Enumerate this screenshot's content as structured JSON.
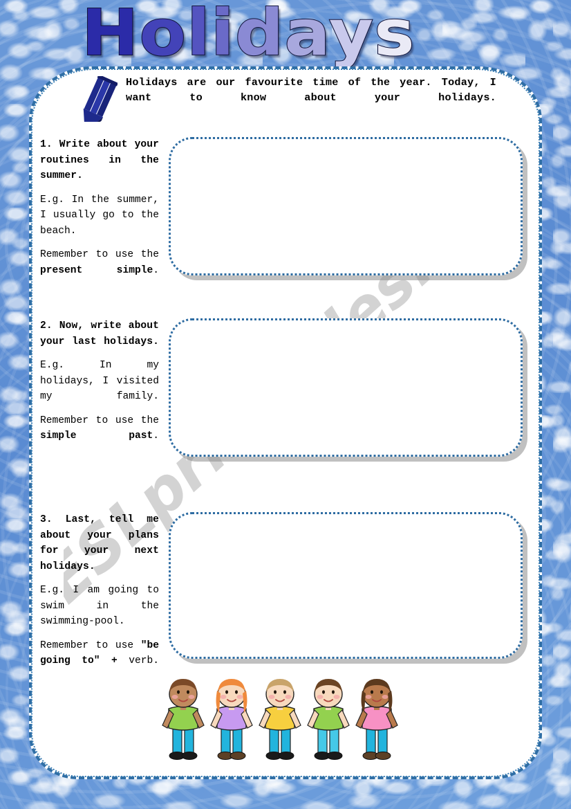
{
  "worksheet": {
    "title": "Holidays",
    "title_letters": [
      "H",
      "o",
      "l",
      "i",
      "d",
      "a",
      "y",
      "s"
    ],
    "title_letter_colors": [
      "#2b2ba8",
      "#4343b8",
      "#5454c0",
      "#6a6ac8",
      "#8a8ad4",
      "#a8a8de",
      "#c9c9ec",
      "#eaeaf6"
    ],
    "watermark": "ESLprintables.com",
    "background_color": "#5d8ed5",
    "card_color": "#ffffff",
    "border_color": "#2e6ca2",
    "pencil_color": "#1e2a8c"
  },
  "header": {
    "icon": "pencil-icon",
    "intro": "Holidays are our favourite time of the year. Today, I want to know about your holidays."
  },
  "tasks": [
    {
      "number": "1.",
      "heading": "1. Write about your routines in the summer.",
      "example": "E.g. In the summer, I usually go to the beach.",
      "reminder_prefix": "Remember to use the ",
      "reminder_bold": "present simple",
      "reminder_suffix": ".",
      "answer_placeholder": ""
    },
    {
      "number": "2.",
      "heading": "2. Now, write about your last holidays.",
      "example": "E.g. In my holidays, I visited my family.",
      "reminder_prefix": "Remember to use the ",
      "reminder_bold": "simple past",
      "reminder_suffix": ".",
      "answer_placeholder": ""
    },
    {
      "number": "3.",
      "heading": "3. Last, tell me about your plans for your next holidays.",
      "example": "E.g. I am going to swim in the swimming-pool.",
      "reminder_prefix": "Remember to use ",
      "reminder_bold": "\"be going to\" +",
      "reminder_suffix": " verb.",
      "answer_placeholder": ""
    }
  ],
  "illustration": {
    "name": "five-children-holding-hands",
    "children": [
      {
        "hair": "#7b4a28",
        "skin": "#c08a5e",
        "shirt": "#93d14f",
        "pants": "#22b4dd",
        "shoes": "#1a1a1a"
      },
      {
        "hair": "#ef8a3c",
        "skin": "#f7d9bd",
        "shirt": "#c79af0",
        "pants": "#22b4dd",
        "shoes": "#5c4026"
      },
      {
        "hair": "#c9a46a",
        "skin": "#f7d9bd",
        "shirt": "#f7cf3f",
        "pants": "#22b4dd",
        "shoes": "#1a1a1a"
      },
      {
        "hair": "#6b4423",
        "skin": "#f7d9bd",
        "shirt": "#93d14f",
        "pants": "#45c9e8",
        "shoes": "#1a1a1a"
      },
      {
        "hair": "#5c3a1e",
        "skin": "#b97a4c",
        "shirt": "#f791c4",
        "pants": "#22b4dd",
        "shoes": "#5c4026"
      }
    ]
  }
}
